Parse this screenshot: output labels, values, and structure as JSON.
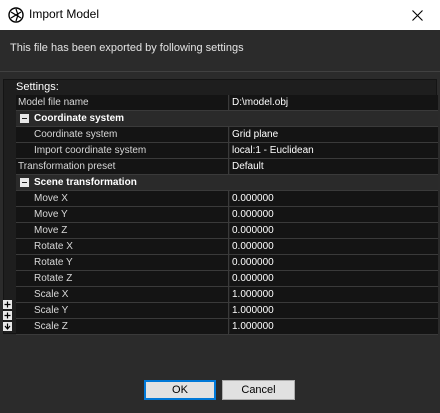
{
  "window": {
    "title": "Import Model",
    "icon": "app-logo-icon",
    "close_icon": "close-icon"
  },
  "info_text": "This file has been exported by following settings",
  "settings": {
    "header": "Settings:",
    "model_file_name": {
      "label": "Model file name",
      "value": "D:\\model.obj"
    },
    "coordinate_group": {
      "label": "Coordinate system",
      "coordinate_system": {
        "label": "Coordinate system",
        "value": "Grid plane"
      },
      "import_coordinate_system": {
        "label": "Import coordinate system",
        "value": "local:1 - Euclidean"
      }
    },
    "transformation_preset": {
      "label": "Transformation preset",
      "value": "Default"
    },
    "scene_group": {
      "label": "Scene transformation",
      "rows": [
        {
          "label": "Move X",
          "value": "0.000000"
        },
        {
          "label": "Move Y",
          "value": "0.000000"
        },
        {
          "label": "Move Z",
          "value": "0.000000"
        },
        {
          "label": "Rotate X",
          "value": "0.000000"
        },
        {
          "label": "Rotate Y",
          "value": "0.000000"
        },
        {
          "label": "Rotate Z",
          "value": "0.000000"
        },
        {
          "label": "Scale X",
          "value": "1.000000"
        },
        {
          "label": "Scale Y",
          "value": "1.000000"
        },
        {
          "label": "Scale Z",
          "value": "1.000000"
        }
      ]
    }
  },
  "buttons": {
    "ok": "OK",
    "cancel": "Cancel"
  },
  "colors": {
    "accent": "#0078d7",
    "background": "#2b2b2b",
    "grid_background": "#141414"
  }
}
